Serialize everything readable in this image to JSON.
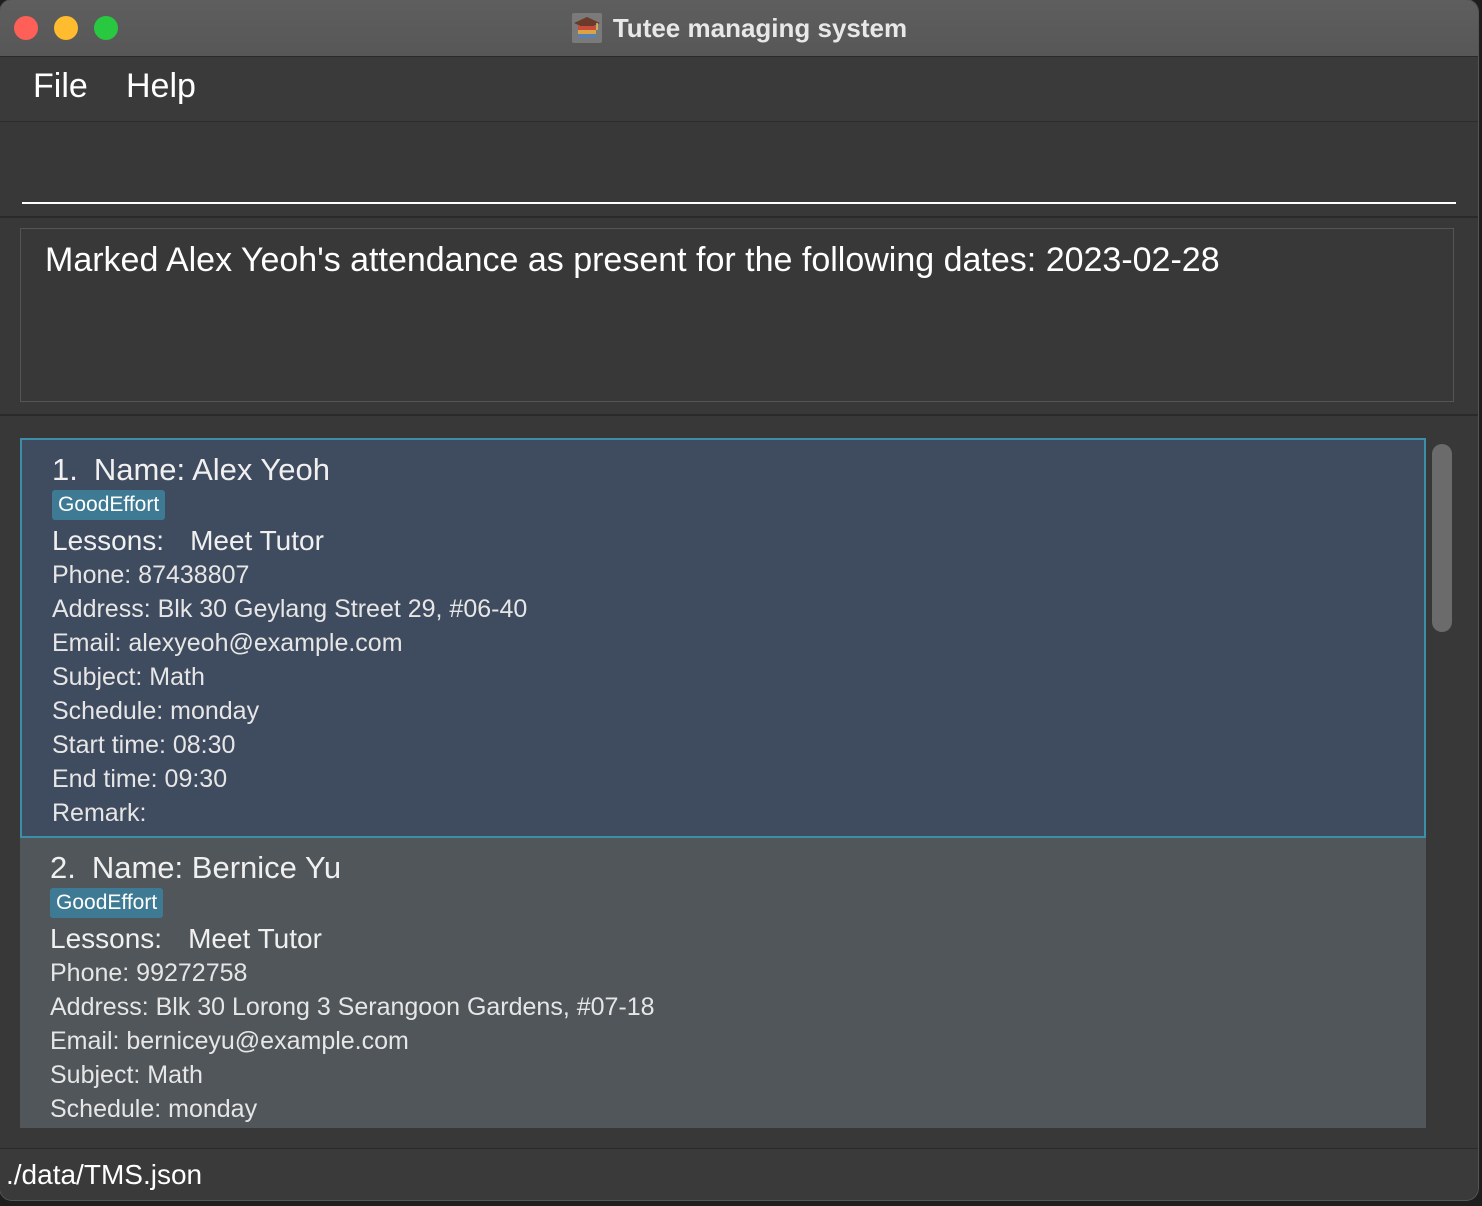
{
  "window": {
    "title": "Tutee managing system",
    "app_icon": "graduation-cap-books-icon"
  },
  "menu": {
    "file_label": "File",
    "help_label": "Help"
  },
  "command_box": {
    "value": "",
    "placeholder": ""
  },
  "result": {
    "message": "Marked Alex Yeoh's attendance as present for the following dates: 2023-02-28"
  },
  "tutees": [
    {
      "index": "1.",
      "name": "Name: Alex Yeoh",
      "tag": "GoodEffort",
      "lessons_label": "Lessons:",
      "lessons_value": "Meet Tutor",
      "phone": "Phone: 87438807",
      "address": "Address: Blk 30 Geylang Street 29, #06-40",
      "email": "Email: alexyeoh@example.com",
      "subject": "Subject: Math",
      "schedule": "Schedule: monday",
      "start_time": "Start time: 08:30",
      "end_time": "End time: 09:30",
      "remark": "Remark:"
    },
    {
      "index": "2.",
      "name": "Name: Bernice Yu",
      "tag": "GoodEffort",
      "lessons_label": "Lessons:",
      "lessons_value": "Meet Tutor",
      "phone": "Phone: 99272758",
      "address": "Address: Blk 30 Lorong 3 Serangoon Gardens, #07-18",
      "email": "Email: berniceyu@example.com",
      "subject": "Subject: Math",
      "schedule": "Schedule: monday"
    }
  ],
  "status_bar": {
    "file_path": "./data/TMS.json"
  },
  "colors": {
    "selected_card_bg": "#3f4b5e",
    "selected_card_border": "#3d8fa7",
    "card_bg": "#50565a",
    "tag_bg": "#3f7a94",
    "window_bg": "#383838"
  }
}
